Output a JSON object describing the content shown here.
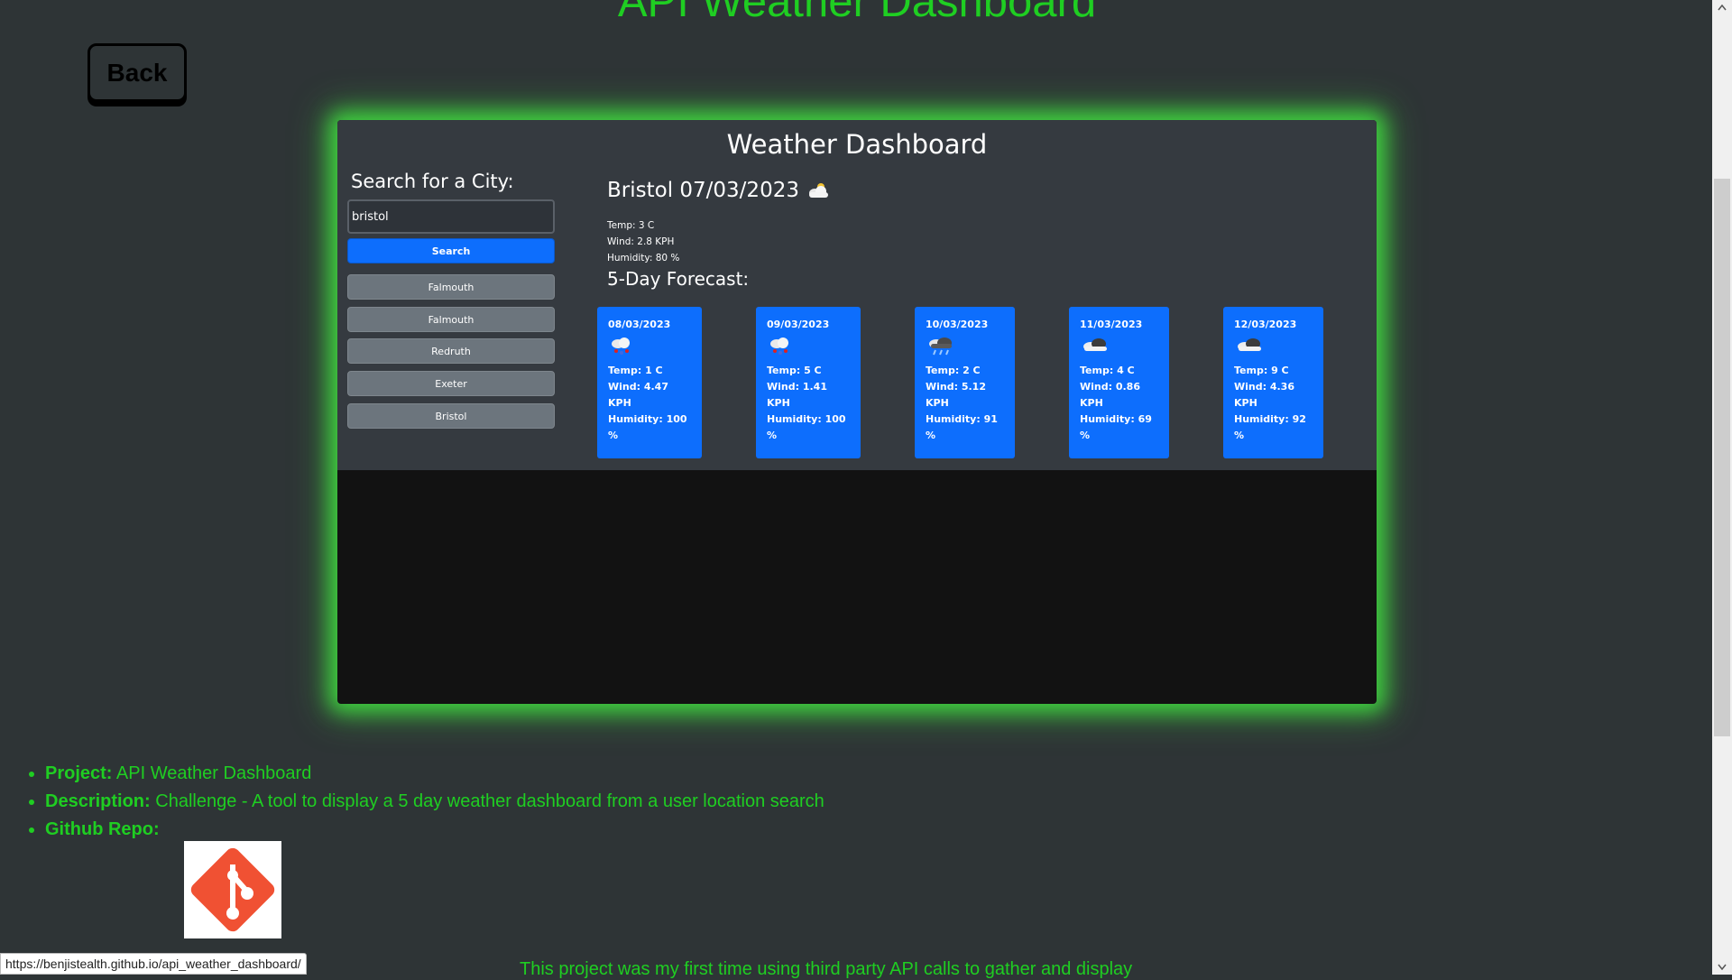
{
  "page": {
    "title": "API Weather Dashboard",
    "back_label": "Back"
  },
  "dashboard": {
    "title": "Weather Dashboard",
    "search_label": "Search for a City:",
    "search_value": "bristol",
    "search_button": "Search",
    "history": [
      "Falmouth",
      "Falmouth",
      "Redruth",
      "Exeter",
      "Bristol"
    ],
    "current": {
      "heading": "Bristol 07/03/2023",
      "icon": "cloud-icon",
      "temp": "Temp: 3 C",
      "wind": "Wind: 2.8 KPH",
      "humidity": "Humidity: 80 %"
    },
    "forecast_heading": "5-Day Forecast:",
    "forecast": [
      {
        "date": "08/03/2023",
        "icon": "snow-rain-icon",
        "temp": "Temp: 1 C",
        "wind": "Wind: 4.47 KPH",
        "humidity": "Humidity: 100 %"
      },
      {
        "date": "09/03/2023",
        "icon": "snow-rain-icon",
        "temp": "Temp: 5 C",
        "wind": "Wind: 1.41 KPH",
        "humidity": "Humidity: 100 %"
      },
      {
        "date": "10/03/2023",
        "icon": "rain-cloud-icon",
        "temp": "Temp: 2 C",
        "wind": "Wind: 5.12 KPH",
        "humidity": "Humidity: 91 %"
      },
      {
        "date": "11/03/2023",
        "icon": "dark-cloud-icon",
        "temp": "Temp: 4 C",
        "wind": "Wind: 0.86 KPH",
        "humidity": "Humidity: 69 %"
      },
      {
        "date": "12/03/2023",
        "icon": "dark-cloud-icon",
        "temp": "Temp: 9 C",
        "wind": "Wind: 4.36 KPH",
        "humidity": "Humidity: 92 %"
      }
    ]
  },
  "footer": {
    "project_label": "Project:",
    "project_value": "API Weather Dashboard",
    "description_label": "Description:",
    "description_value": "Challenge - A tool to display a 5 day weather dashboard from a user location search",
    "repo_label": "Github Repo:",
    "repo_icon": "git-logo-icon",
    "bottom_text": "This project was my first time using third party API calls to gather and display"
  },
  "status_bar": {
    "url": "https://benjistealth.github.io/api_weather_dashboard/"
  },
  "colors": {
    "accent_green": "#1fce22",
    "card_blue": "#0d6efd",
    "history_grey": "#6c757d",
    "panel_bg": "#353a40",
    "page_bg": "#2e3436"
  }
}
